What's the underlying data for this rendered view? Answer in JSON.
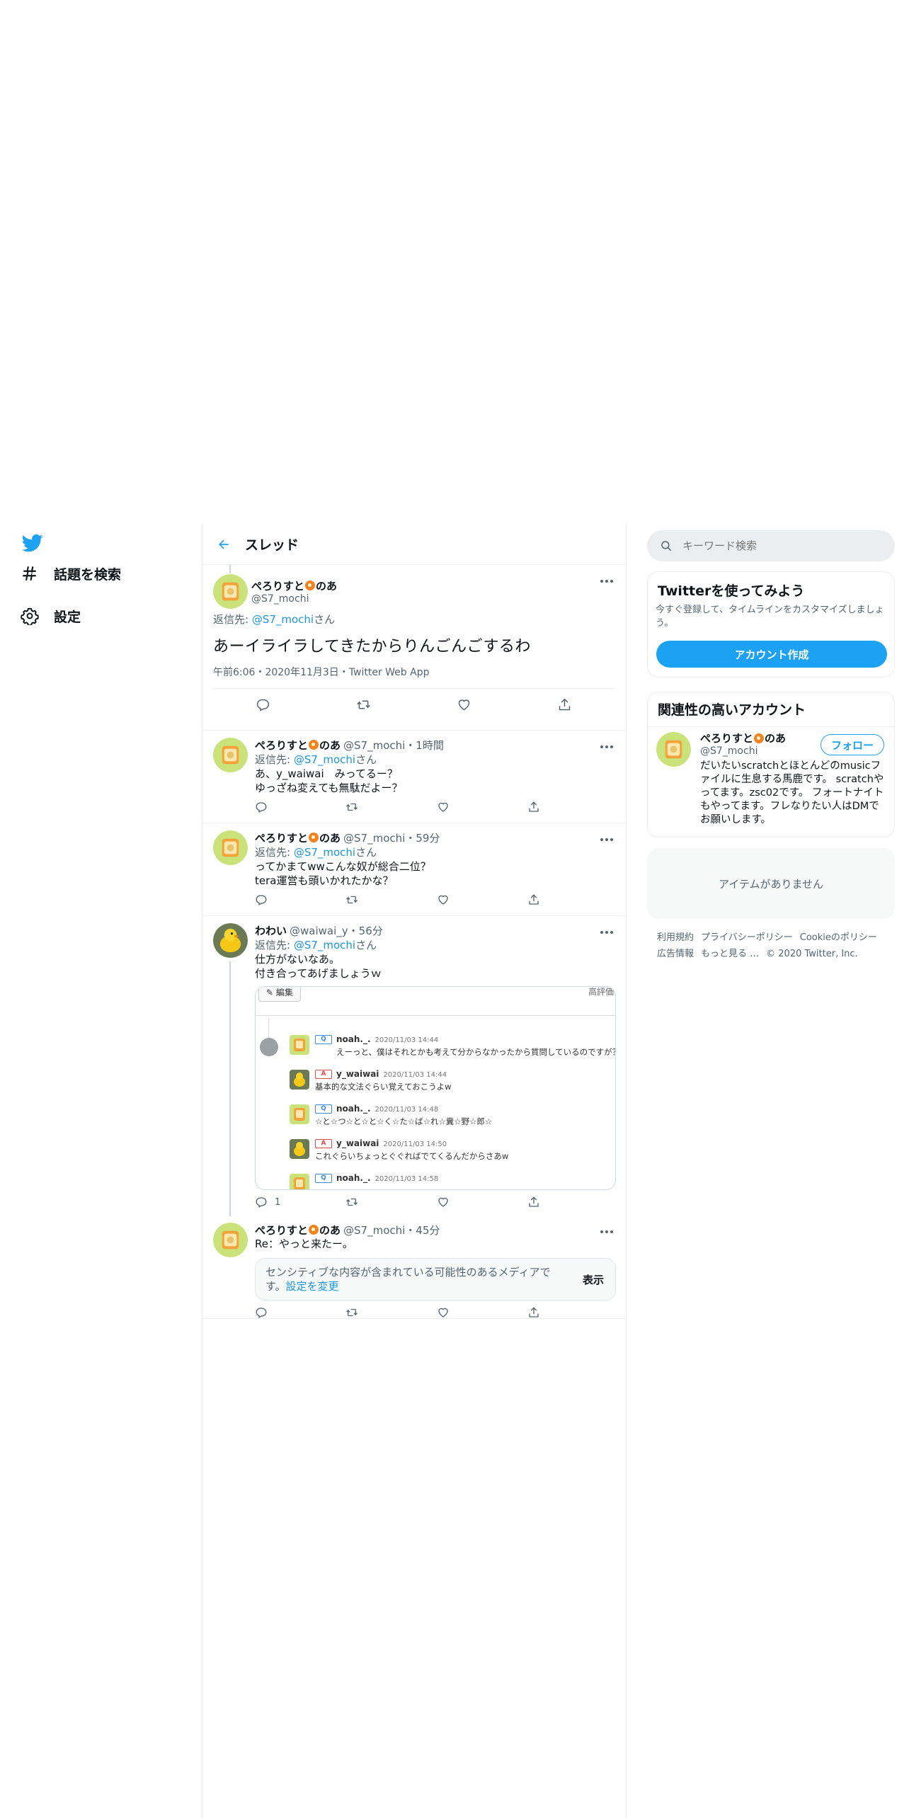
{
  "nav": {
    "explore_label": "話題を検索",
    "settings_label": "設定"
  },
  "header": {
    "title": "スレッド"
  },
  "focus_tweet": {
    "display_name_1": "ぺろりすと",
    "display_name_2": "のあ",
    "handle": "@S7_mochi",
    "replying_prefix": "返信先: ",
    "replying_handle": "@S7_mochi",
    "replying_suffix": "さん",
    "text": "あーイライラしてきたからりんごんごするわ",
    "meta": "午前6:06・2020年11月3日・Twitter Web App"
  },
  "replies": [
    {
      "name_1": "ぺろりすと",
      "name_2": "のあ",
      "handle": "@S7_mochi・1時間",
      "rep_prefix": "返信先: ",
      "rep_handle": "@S7_mochi",
      "rep_suffix": "さん",
      "text": "あ、y_waiwai　みってるー？\nゆっざね変えても無駄だよー？"
    },
    {
      "name_1": "ぺろりすと",
      "name_2": "のあ",
      "handle": "@S7_mochi・59分",
      "rep_prefix": "返信先: ",
      "rep_handle": "@S7_mochi",
      "rep_suffix": "さん",
      "text": "ってかまてwwこんな奴が総合二位？\ntera運営も頭いかれたかな？"
    },
    {
      "name_1": "わわい",
      "name_2": "",
      "handle": "@waiwai_y・56分",
      "rep_prefix": "返信先: ",
      "rep_handle": "@S7_mochi",
      "rep_suffix": "さん",
      "text": "仕方がないなあ。\n付き合ってあげましょうｗ",
      "reply_count": "1",
      "card": {
        "edit_label": "編集",
        "corner_label": "高評価",
        "entries": [
          {
            "tag": "Q",
            "user": "noah._.",
            "date": "2020/11/03 14:44",
            "msg": "えーっと、僕はそれとかも考えて分からなかったから質問しているのですが？"
          },
          {
            "tag": "A",
            "user": "y_waiwai",
            "date": "2020/11/03 14:44",
            "msg": "基本的な文法ぐらい覚えておこうよw"
          },
          {
            "tag": "Q",
            "user": "noah._.",
            "date": "2020/11/03 14:48",
            "msg": "☆と☆つ☆と☆と☆く☆た☆ば☆れ☆糞☆野☆郎☆"
          },
          {
            "tag": "A",
            "user": "y_waiwai",
            "date": "2020/11/03 14:50",
            "msg": "これぐらいちょっとぐぐればでてくるんだからさあw"
          },
          {
            "tag": "Q",
            "user": "noah._.",
            "date": "2020/11/03 14:58",
            "msg": ""
          }
        ]
      }
    },
    {
      "name_1": "ぺろりすと",
      "name_2": "のあ",
      "handle": "@S7_mochi・45分",
      "text": "Re：やっと来たー。",
      "sensitive_text": "センシティブな内容が含まれている可能性のあるメディアです。",
      "sensitive_link": "設定を変更",
      "show_label": "表示"
    }
  ],
  "sidebar": {
    "search_placeholder": "キーワード検索",
    "signup": {
      "title": "Twitterを使ってみよう",
      "desc": "今すぐ登録して、タイムラインをカスタマイズしましょう。",
      "button": "アカウント作成"
    },
    "related": {
      "title": "関連性の高いアカウント",
      "name_1": "ぺろりすと",
      "name_2": "のあ",
      "handle": "@S7_mochi",
      "follow": "フォロー",
      "bio": "だいたいscratchとほとんどのmusicファイルに生息する馬鹿です。 scratchやってます。zsc02です。 フォートナイトもやってます。フレなりたい人はDMでお願いします。"
    },
    "empty_text": "アイテムがありません",
    "footer": {
      "terms": "利用規約",
      "privacy": "プライバシーポリシー",
      "cookie": "Cookieのポリシー",
      "ads": "広告情報",
      "more": "もっと見る …",
      "copyright": "© 2020 Twitter, Inc."
    }
  },
  "colors": {
    "accent": "#1da1f2",
    "link": "#1b95e0",
    "muted": "#536471",
    "border": "#ebeef0"
  }
}
